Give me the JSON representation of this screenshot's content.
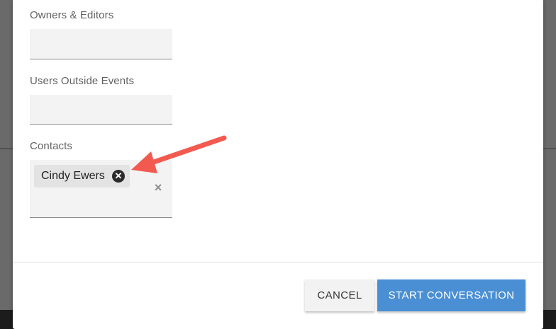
{
  "form": {
    "owners_label": "Owners & Editors",
    "owners_value": "",
    "users_outside_label": "Users Outside Events",
    "users_outside_value": "",
    "contacts_label": "Contacts",
    "contacts_chips": [
      {
        "label": "Cindy Ewers"
      }
    ]
  },
  "footer": {
    "cancel_label": "CANCEL",
    "start_label": "START CONVERSATION"
  },
  "colors": {
    "primary": "#4a8fd3",
    "annotation_arrow": "#f25a50"
  },
  "icons": {
    "chip_remove": "close-circle-icon",
    "clear": "close-icon"
  }
}
